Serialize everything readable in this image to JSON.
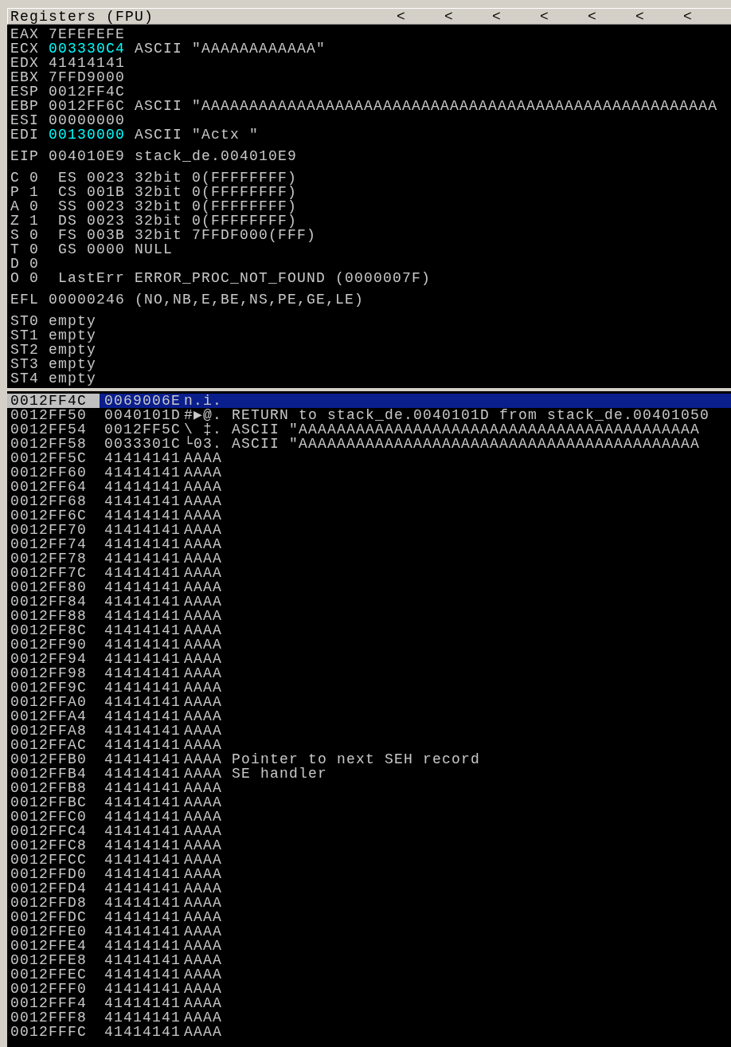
{
  "registers_panel": {
    "title": "Registers (FPU)",
    "arrows": [
      "<",
      "<",
      "<",
      "<",
      "<",
      "<",
      "<"
    ],
    "registers": [
      {
        "name": "EAX",
        "value": "7EFEFEFE",
        "highlighted": false
      },
      {
        "name": "ECX",
        "value": "003330C4",
        "highlighted": true,
        "comment": "ASCII \"AAAAAAAAAAAA\""
      },
      {
        "name": "EDX",
        "value": "41414141",
        "highlighted": false
      },
      {
        "name": "EBX",
        "value": "7FFD9000",
        "highlighted": false
      },
      {
        "name": "ESP",
        "value": "0012FF4C",
        "highlighted": false
      },
      {
        "name": "EBP",
        "value": "0012FF6C",
        "highlighted": false,
        "comment": "ASCII \"AAAAAAAAAAAAAAAAAAAAAAAAAAAAAAAAAAAAAAAAAAAAAAAAAAAAAA"
      },
      {
        "name": "ESI",
        "value": "00000000",
        "highlighted": false
      },
      {
        "name": "EDI",
        "value": "00130000",
        "highlighted": true,
        "comment": "ASCII \"Actx \""
      }
    ],
    "eip": {
      "name": "EIP",
      "value": "004010E9",
      "highlighted": false,
      "comment": "stack_de.004010E9"
    },
    "flags": [
      {
        "flag": "C",
        "bit": "0",
        "info": "ES 0023 32bit 0(FFFFFFFF)"
      },
      {
        "flag": "P",
        "bit": "1",
        "info": "CS 001B 32bit 0(FFFFFFFF)"
      },
      {
        "flag": "A",
        "bit": "0",
        "info": "SS 0023 32bit 0(FFFFFFFF)"
      },
      {
        "flag": "Z",
        "bit": "1",
        "info": "DS 0023 32bit 0(FFFFFFFF)"
      },
      {
        "flag": "S",
        "bit": "0",
        "info": "FS 003B 32bit 7FFDF000(FFF)"
      },
      {
        "flag": "T",
        "bit": "0",
        "info": "GS 0000 NULL"
      },
      {
        "flag": "D",
        "bit": "0"
      },
      {
        "flag": "O",
        "bit": "0",
        "info": "LastErr ERROR_PROC_NOT_FOUND (0000007F)"
      }
    ],
    "efl": {
      "name": "EFL",
      "value": "00000246",
      "comment": "(NO,NB,E,BE,NS,PE,GE,LE)"
    },
    "fpu": [
      {
        "name": "ST0",
        "value": "empty"
      },
      {
        "name": "ST1",
        "value": "empty"
      },
      {
        "name": "ST2",
        "value": "empty"
      },
      {
        "name": "ST3",
        "value": "empty"
      },
      {
        "name": "ST4",
        "value": "empty"
      }
    ]
  },
  "stack": [
    {
      "address": "0012FF4C",
      "value": "0069006E",
      "ascii": "n.i.",
      "selected": true
    },
    {
      "address": "0012FF50",
      "value": "0040101D",
      "ascii": "#▶@.",
      "comment": "RETURN to stack_de.0040101D from stack_de.00401050",
      "selected": false
    },
    {
      "address": "0012FF54",
      "value": "0012FF5C",
      "ascii": "\\ ‡.",
      "comment": "ASCII \"AAAAAAAAAAAAAAAAAAAAAAAAAAAAAAAAAAAAAAAAAA",
      "selected": false
    },
    {
      "address": "0012FF58",
      "value": "0033301C",
      "ascii": "└03.",
      "comment": "ASCII \"AAAAAAAAAAAAAAAAAAAAAAAAAAAAAAAAAAAAAAAAAA",
      "selected": false
    },
    {
      "address": "0012FF5C",
      "value": "41414141",
      "ascii": "AAAA",
      "selected": false
    },
    {
      "address": "0012FF60",
      "value": "41414141",
      "ascii": "AAAA",
      "selected": false
    },
    {
      "address": "0012FF64",
      "value": "41414141",
      "ascii": "AAAA",
      "selected": false
    },
    {
      "address": "0012FF68",
      "value": "41414141",
      "ascii": "AAAA",
      "selected": false
    },
    {
      "address": "0012FF6C",
      "value": "41414141",
      "ascii": "AAAA",
      "selected": false
    },
    {
      "address": "0012FF70",
      "value": "41414141",
      "ascii": "AAAA",
      "selected": false
    },
    {
      "address": "0012FF74",
      "value": "41414141",
      "ascii": "AAAA",
      "selected": false
    },
    {
      "address": "0012FF78",
      "value": "41414141",
      "ascii": "AAAA",
      "selected": false
    },
    {
      "address": "0012FF7C",
      "value": "41414141",
      "ascii": "AAAA",
      "selected": false
    },
    {
      "address": "0012FF80",
      "value": "41414141",
      "ascii": "AAAA",
      "selected": false
    },
    {
      "address": "0012FF84",
      "value": "41414141",
      "ascii": "AAAA",
      "selected": false
    },
    {
      "address": "0012FF88",
      "value": "41414141",
      "ascii": "AAAA",
      "selected": false
    },
    {
      "address": "0012FF8C",
      "value": "41414141",
      "ascii": "AAAA",
      "selected": false
    },
    {
      "address": "0012FF90",
      "value": "41414141",
      "ascii": "AAAA",
      "selected": false
    },
    {
      "address": "0012FF94",
      "value": "41414141",
      "ascii": "AAAA",
      "selected": false
    },
    {
      "address": "0012FF98",
      "value": "41414141",
      "ascii": "AAAA",
      "selected": false
    },
    {
      "address": "0012FF9C",
      "value": "41414141",
      "ascii": "AAAA",
      "selected": false
    },
    {
      "address": "0012FFA0",
      "value": "41414141",
      "ascii": "AAAA",
      "selected": false
    },
    {
      "address": "0012FFA4",
      "value": "41414141",
      "ascii": "AAAA",
      "selected": false
    },
    {
      "address": "0012FFA8",
      "value": "41414141",
      "ascii": "AAAA",
      "selected": false
    },
    {
      "address": "0012FFAC",
      "value": "41414141",
      "ascii": "AAAA",
      "selected": false
    },
    {
      "address": "0012FFB0",
      "value": "41414141",
      "ascii": "AAAA",
      "comment": "Pointer to next SEH record",
      "selected": false
    },
    {
      "address": "0012FFB4",
      "value": "41414141",
      "ascii": "AAAA",
      "comment": "SE handler",
      "selected": false
    },
    {
      "address": "0012FFB8",
      "value": "41414141",
      "ascii": "AAAA",
      "selected": false
    },
    {
      "address": "0012FFBC",
      "value": "41414141",
      "ascii": "AAAA",
      "selected": false
    },
    {
      "address": "0012FFC0",
      "value": "41414141",
      "ascii": "AAAA",
      "selected": false
    },
    {
      "address": "0012FFC4",
      "value": "41414141",
      "ascii": "AAAA",
      "selected": false
    },
    {
      "address": "0012FFC8",
      "value": "41414141",
      "ascii": "AAAA",
      "selected": false
    },
    {
      "address": "0012FFCC",
      "value": "41414141",
      "ascii": "AAAA",
      "selected": false
    },
    {
      "address": "0012FFD0",
      "value": "41414141",
      "ascii": "AAAA",
      "selected": false
    },
    {
      "address": "0012FFD4",
      "value": "41414141",
      "ascii": "AAAA",
      "selected": false
    },
    {
      "address": "0012FFD8",
      "value": "41414141",
      "ascii": "AAAA",
      "selected": false
    },
    {
      "address": "0012FFDC",
      "value": "41414141",
      "ascii": "AAAA",
      "selected": false
    },
    {
      "address": "0012FFE0",
      "value": "41414141",
      "ascii": "AAAA",
      "selected": false
    },
    {
      "address": "0012FFE4",
      "value": "41414141",
      "ascii": "AAAA",
      "selected": false
    },
    {
      "address": "0012FFE8",
      "value": "41414141",
      "ascii": "AAAA",
      "selected": false
    },
    {
      "address": "0012FFEC",
      "value": "41414141",
      "ascii": "AAAA",
      "selected": false
    },
    {
      "address": "0012FFF0",
      "value": "41414141",
      "ascii": "AAAA",
      "selected": false
    },
    {
      "address": "0012FFF4",
      "value": "41414141",
      "ascii": "AAAA",
      "selected": false
    },
    {
      "address": "0012FFF8",
      "value": "41414141",
      "ascii": "AAAA",
      "selected": false
    },
    {
      "address": "0012FFFC",
      "value": "41414141",
      "ascii": "AAAA",
      "selected": false
    }
  ]
}
